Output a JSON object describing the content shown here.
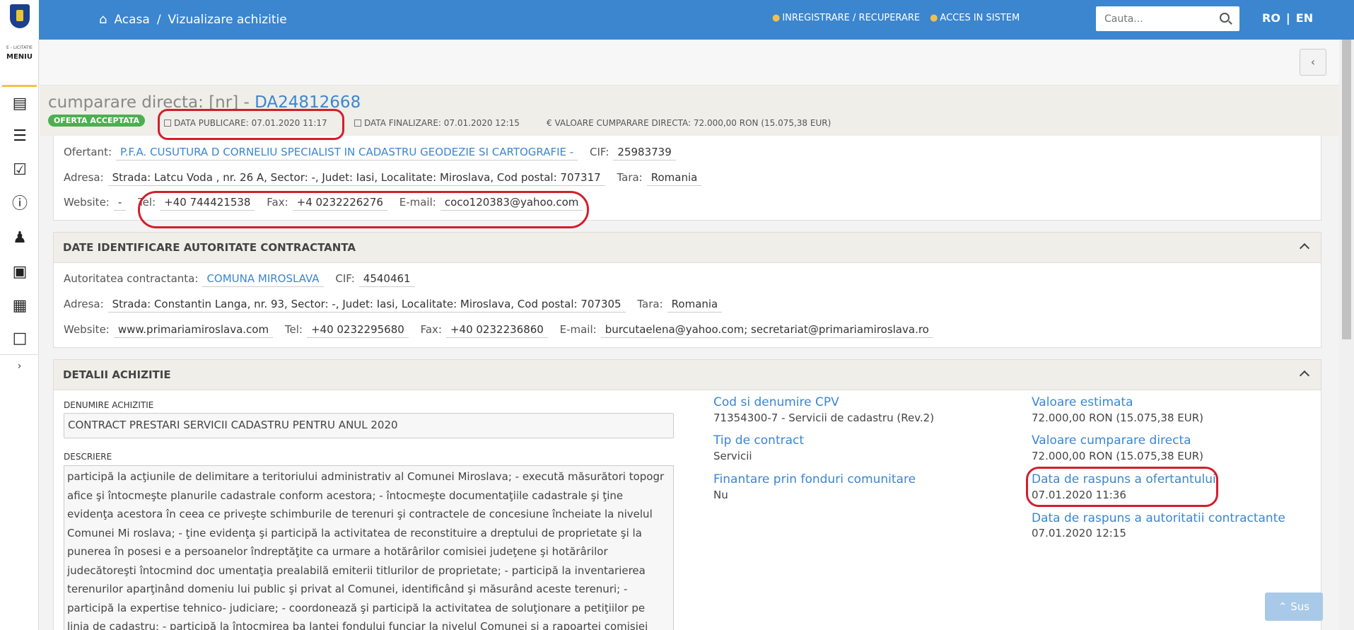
{
  "header": {
    "breadcrumb_home": "Acasa",
    "breadcrumb_sep": "/",
    "breadcrumb_current": "Vizualizare achizitie",
    "link_register": "INREGISTRARE / RECUPERARE",
    "link_access": "ACCES IN SISTEM",
    "search_placeholder": "Cauta...",
    "lang_ro": "RO",
    "lang_sep": "|",
    "lang_en": "EN"
  },
  "sidebar": {
    "brand_small": "E - LICITATIE",
    "menu_label": "MENIU",
    "expand": "›"
  },
  "acquisition": {
    "title_prefix": "cumparare directa: [nr] - ",
    "title_id": "DA24812668",
    "status": "OFERTA ACCEPTATA",
    "data_publicare": "DATA PUBLICARE: 07.01.2020 11:17",
    "data_finalizare": "DATA FINALIZARE: 07.01.2020 12:15",
    "valoare": "€ VALOARE CUMPARARE DIRECTA: 72.000,00  RON (15.075,38  EUR)"
  },
  "ofertant": {
    "label": "Ofertant:",
    "name": "P.F.A. CUSUTURA D CORNELIU SPECIALIST IN CADASTRU GEODEZIE SI CARTOGRAFIE -",
    "cif_label": "CIF:",
    "cif": "25983739",
    "adresa_label": "Adresa:",
    "adresa": "Strada: Latcu Voda , nr. 26 A, Sector: -, Judet: Iasi, Localitate: Miroslava, Cod postal: 707317",
    "tara_label": "Tara:",
    "tara": "Romania",
    "website_label": "Website:",
    "website": "-",
    "tel_label": "Tel:",
    "tel": "+40 744421538",
    "fax_label": "Fax:",
    "fax": "+4 0232226276",
    "email_label": "E-mail:",
    "email": "coco120383@yahoo.com"
  },
  "autoritate": {
    "section_title": "DATE IDENTIFICARE AUTORITATE CONTRACTANTA",
    "label": "Autoritatea contractanta:",
    "name": "COMUNA MIROSLAVA",
    "cif_label": "CIF:",
    "cif": "4540461",
    "adresa_label": "Adresa:",
    "adresa": "Strada: Constantin Langa, nr. 93, Sector: -, Judet: Iasi, Localitate: Miroslava, Cod postal: 707305",
    "tara_label": "Tara:",
    "tara": "Romania",
    "website_label": "Website:",
    "website": "www.primariamiroslava.com",
    "tel_label": "Tel:",
    "tel": "+40 0232295680",
    "fax_label": "Fax:",
    "fax": "+40 0232236860",
    "email_label": "E-mail:",
    "email": "burcutaelena@yahoo.com; secretariat@primariamiroslava.ro"
  },
  "detalii": {
    "section_title": "DETALII ACHIZITIE",
    "denumire_label": "DENUMIRE ACHIZITIE",
    "denumire": "CONTRACT PRESTARI SERVICII CADASTRU PENTRU ANUL 2020",
    "descriere_label": "DESCRIERE",
    "descriere": "participă la acţiunile de delimitare a teritoriului administrativ al Comunei Miroslava; - execută măsurători topogr afice şi întocmeşte planurile cadastrale conform acestora; - întocmeşte documentaţiile cadastrale şi ţine evidenţa acestora în ceea ce priveşte schimburile de terenuri şi contractele de concesiune încheiate la nivelul Comunei Mi roslava; - ţine evidenţa şi participă la activitatea de reconstituire a dreptului de proprietate şi la punerea în posesi e a persoanelor îndreptăţite ca urmare a hotărârilor comisiei judeţene şi hotărârilor judecătoreşti întocmind doc umentaţia prealabilă emiterii titlurilor de proprietate; - participă la inventarierea terenurilor aparţinând domeniu lui public şi privat al Comunei, identificând şi măsurând aceste terenuri; - participă la expertise tehnico- judiciare; - coordonează şi participă la activitatea de soluţionare a petiţiilor pe linia de cadastru; - participă la întocmirea ba lantei fondului funciar la nivelul Comunei şi a rapoartei comisiei locale de fond funciar; - consultanţă de specialitat",
    "cpv_label": "Cod si denumire CPV",
    "cpv": "71354300-7 - Servicii de cadastru (Rev.2)",
    "tip_label": "Tip de contract",
    "tip": "Servicii",
    "finantare_label": "Finantare prin fonduri comunitare",
    "finantare": "Nu",
    "val_estimata_label": "Valoare estimata",
    "val_estimata": "72.000,00  RON (15.075,38  EUR)",
    "val_cumparare_label": "Valoare cumparare directa",
    "val_cumparare": "72.000,00  RON (15.075,38  EUR)",
    "raspuns_ofertant_label": "Data de raspuns a ofertantului",
    "raspuns_ofertant": "07.01.2020 11:36",
    "raspuns_autoritate_label": "Data de raspuns a autoritatii contractante",
    "raspuns_autoritate": "07.01.2020 12:15"
  },
  "back_to_top": "Sus",
  "colors": {
    "topbar": "#3b86cf",
    "link": "#3b86cf",
    "badge": "#4caf50",
    "annotation": "#d21f2c"
  }
}
